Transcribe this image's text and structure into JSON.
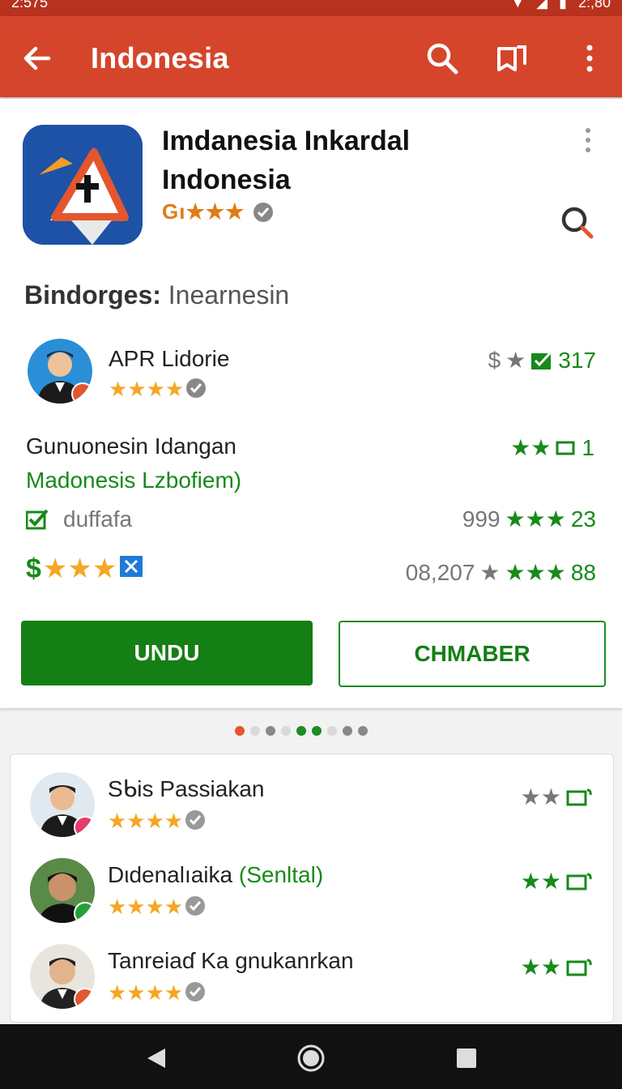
{
  "status_bar": {
    "time": "2:575",
    "right_text": "2:,80"
  },
  "app_bar": {
    "title": "Indonesia"
  },
  "app": {
    "name_line1": "Imdanesia Inkardal",
    "name_line2": "Indonesia",
    "rating_text": "Gı★★★",
    "section_label": "Bindorges:",
    "section_value": "Inearnesin"
  },
  "developer": {
    "name": "APR Lidorie",
    "stars": "★★★★",
    "meta_prefix": "$",
    "meta_stars": "★",
    "meta_value": "317"
  },
  "details": {
    "line1_left": "Gunuonesin Idangan",
    "line1_right": "1",
    "line2_link": "Madonesis  Lzbofiem)",
    "line3_left": "duffafa",
    "line3_count": "999",
    "line3_stars": "★★★",
    "line3_value": "23",
    "line4_stars": "★★★",
    "line4_count": "08,207",
    "line4_stars_right": "★★★",
    "line4_value": "88"
  },
  "buttons": {
    "primary": "UNDU",
    "secondary": "CHMABER"
  },
  "pager": {
    "dot_colors": [
      "#e4562d",
      "#d9d9d9",
      "#888888",
      "#d9d9d9",
      "#1e8c22",
      "#1e8c22",
      "#d9d9d9",
      "#888888",
      "#888888"
    ]
  },
  "reviewers": [
    {
      "name": "Sᑲis Passiakan",
      "stars": "★★★★",
      "right_stars": "★★",
      "badge_color": "#e33d6a"
    },
    {
      "name": "Dιdenalıaika ",
      "name_green": "(Senltal)",
      "stars": "★★★★",
      "right_stars": "★★",
      "badge_color": "#24a03a"
    },
    {
      "name": "Tanreiaɗ Ka gnukanrkan",
      "stars": "★★★★",
      "right_stars": "★★",
      "badge_color": "#e4562d"
    }
  ],
  "colors": {
    "app_bar": "#d5452b",
    "status_bar": "#b8321e",
    "primary_green": "#137f14",
    "star_orange": "#f5a623"
  }
}
